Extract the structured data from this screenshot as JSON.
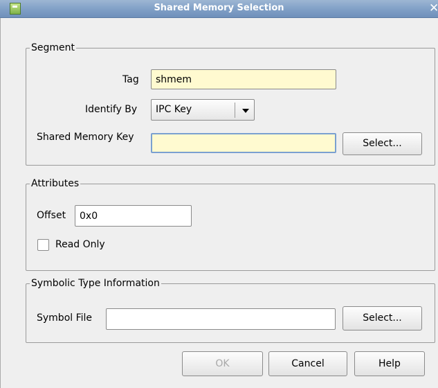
{
  "window": {
    "title": "Shared Memory Selection",
    "close_symbol": "✕"
  },
  "segment": {
    "legend": "Segment",
    "tag_label": "Tag",
    "tag_value": "shmem",
    "identify_label": "Identify By",
    "identify_value": "IPC Key",
    "key_label": "Shared Memory Key",
    "key_value": "",
    "select_label": "Select..."
  },
  "attributes": {
    "legend": "Attributes",
    "offset_label": "Offset",
    "offset_value": "0x0",
    "readonly_label": "Read Only",
    "readonly_checked": false
  },
  "symbolic": {
    "legend": "Symbolic Type Information",
    "symbol_file_label": "Symbol File",
    "symbol_file_value": "",
    "select_label": "Select..."
  },
  "footer": {
    "ok_label": "OK",
    "ok_enabled": false,
    "cancel_label": "Cancel",
    "help_label": "Help"
  },
  "icons": {
    "app": "app-icon",
    "close": "close-icon",
    "dropdown": "chevron-down-icon"
  }
}
